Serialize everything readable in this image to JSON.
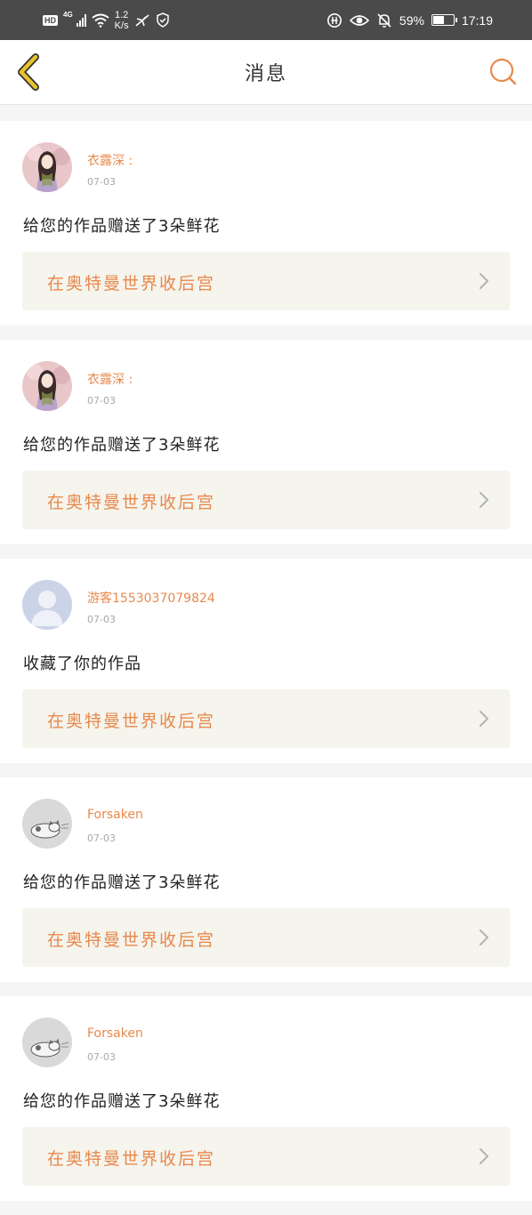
{
  "status_bar": {
    "hd": "HD",
    "network": "4G",
    "speed_value": "1.2",
    "speed_unit": "K/s",
    "battery": "59%",
    "battery_level": 0.59,
    "time": "17:19"
  },
  "header": {
    "title": "消息"
  },
  "colors": {
    "accent": "#e8894d",
    "back_arrow": "#e8c22f",
    "link_bg": "#f5f4ed"
  },
  "messages": [
    {
      "name": "衣露深 :",
      "date": "07-03",
      "text": "给您的作品赠送了3朵鲜花",
      "work": "在奥特曼世界收后宫",
      "avatar": "illustrated-girl-avatar"
    },
    {
      "name": "衣露深 :",
      "date": "07-03",
      "text": "给您的作品赠送了3朵鲜花",
      "work": "在奥特曼世界收后宫",
      "avatar": "illustrated-girl-avatar"
    },
    {
      "name": "游客1553037079824",
      "date": "07-03",
      "text": "收藏了你的作品",
      "work": "在奥特曼世界收后宫",
      "avatar": "default-user-avatar"
    },
    {
      "name": "Forsaken",
      "date": "07-03",
      "text": "给您的作品赠送了3朵鲜花",
      "work": "在奥特曼世界收后宫",
      "avatar": "cat-avatar"
    },
    {
      "name": "Forsaken",
      "date": "07-03",
      "text": "给您的作品赠送了3朵鲜花",
      "work": "在奥特曼世界收后宫",
      "avatar": "cat-avatar"
    }
  ]
}
